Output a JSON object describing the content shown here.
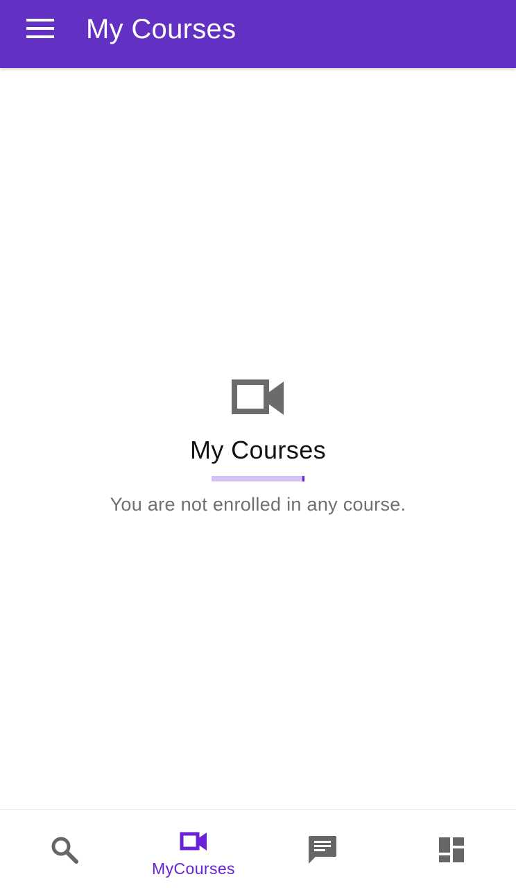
{
  "app_bar": {
    "title": "My Courses",
    "menu_icon": "hamburger-menu-icon"
  },
  "empty_state": {
    "icon": "videocam-icon",
    "title": "My Courses",
    "message": "You are not enrolled in any course.",
    "loading_progress": 0.02
  },
  "bottom_nav": {
    "items": [
      {
        "id": "search",
        "icon": "search-icon",
        "label": "",
        "active": false
      },
      {
        "id": "mycourses",
        "icon": "videocam-icon",
        "label": "MyCourses",
        "active": true
      },
      {
        "id": "messages",
        "icon": "chat-icon",
        "label": "",
        "active": false
      },
      {
        "id": "dashboard",
        "icon": "dashboard-icon",
        "label": "",
        "active": false
      }
    ]
  },
  "colors": {
    "primary": "#6330c4",
    "accent": "#6a22d6",
    "progress_track": "#d4c2f4",
    "icon_inactive": "#666666",
    "text_secondary": "#6f6f6f"
  }
}
